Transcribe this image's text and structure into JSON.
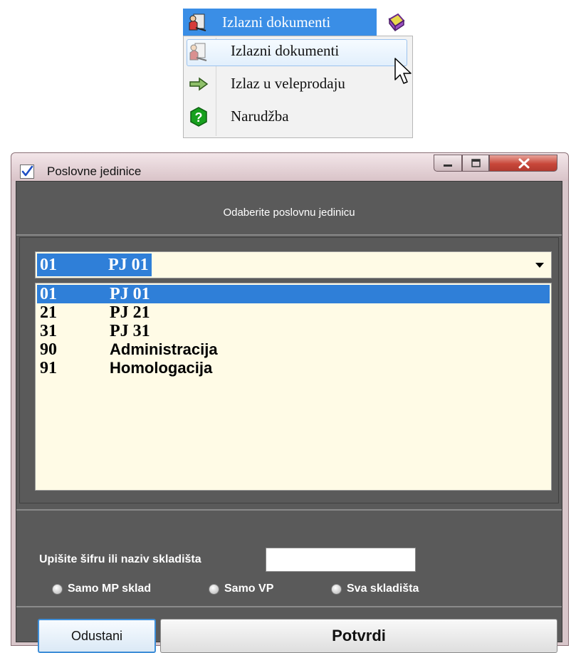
{
  "menu": {
    "header_label": "Izlazni dokumenti",
    "items": [
      {
        "label": "Izlazni dokumenti",
        "icon": "document-user-icon",
        "hovered": true
      },
      {
        "label": "Izlaz u veleprodaju",
        "icon": "green-arrow-right-icon",
        "hovered": false
      },
      {
        "label": "Narudžba",
        "icon": "green-question-icon",
        "hovered": false
      }
    ]
  },
  "dialog": {
    "title": "Poslovne jedinice",
    "header_text": "Odaberite poslovnu jedinicu",
    "selected": {
      "code": "01",
      "name": "PJ 01"
    },
    "units": [
      {
        "code": "01",
        "name": "PJ 01"
      },
      {
        "code": "21",
        "name": "PJ 21"
      },
      {
        "code": "31",
        "name": "PJ 31"
      },
      {
        "code": "90",
        "name": "Administracija"
      },
      {
        "code": "91",
        "name": "Homologacija"
      }
    ],
    "search_label": "Upišite šifru ili naziv skladišta",
    "search_value": "",
    "radios": [
      {
        "label": "Samo MP sklad"
      },
      {
        "label": "Samo VP"
      },
      {
        "label": "Sva skladišta"
      }
    ],
    "cancel_label": "Odustani",
    "confirm_label": "Potvrdi"
  },
  "colors": {
    "accent": "#2f7fd8",
    "list_bg": "#fffbe6",
    "panel_bg": "#5a5a5a"
  }
}
